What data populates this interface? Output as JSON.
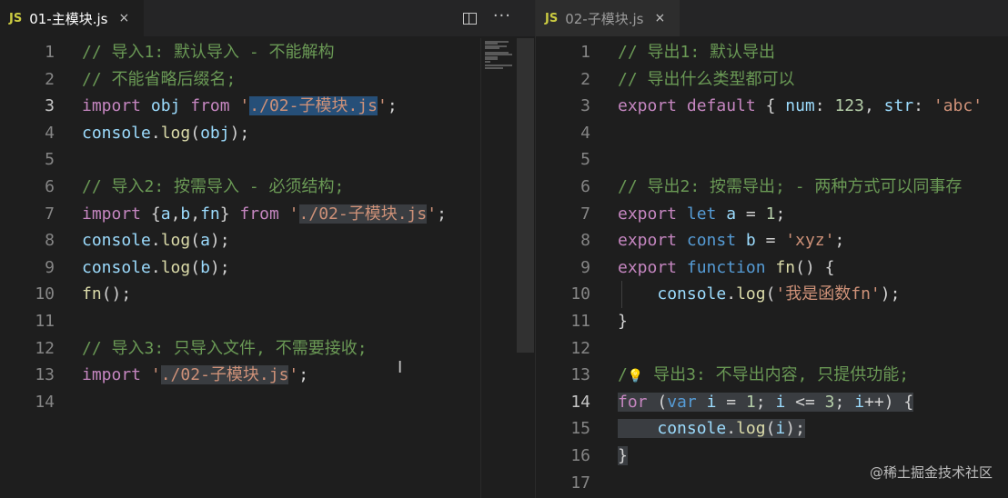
{
  "left": {
    "tab": {
      "badge": "JS",
      "title": "01-主模块.js",
      "close": "×"
    },
    "actions": {
      "more": "···"
    },
    "lines": [
      {
        "num": "1",
        "tokens": [
          {
            "t": "// 导入1: 默认导入 - 不能解构",
            "c": "c"
          }
        ]
      },
      {
        "num": "2",
        "tokens": [
          {
            "t": "// 不能省略后缀名;",
            "c": "c"
          }
        ]
      },
      {
        "num": "3",
        "tokens": [
          {
            "t": "import",
            "c": "kc"
          },
          {
            "t": " ",
            "c": "p"
          },
          {
            "t": "obj",
            "c": "v"
          },
          {
            "t": " ",
            "c": "p"
          },
          {
            "t": "from",
            "c": "kc"
          },
          {
            "t": " '",
            "c": "s"
          },
          {
            "t": "./02-子模块.js",
            "c": "s hl"
          },
          {
            "t": "'",
            "c": "s"
          },
          {
            "t": ";",
            "c": "p"
          }
        ]
      },
      {
        "num": "4",
        "tokens": [
          {
            "t": "console",
            "c": "v"
          },
          {
            "t": ".",
            "c": "p"
          },
          {
            "t": "log",
            "c": "f"
          },
          {
            "t": "(",
            "c": "p"
          },
          {
            "t": "obj",
            "c": "v"
          },
          {
            "t": ");",
            "c": "p"
          }
        ]
      },
      {
        "num": "5",
        "tokens": []
      },
      {
        "num": "6",
        "tokens": [
          {
            "t": "// 导入2: 按需导入 - 必须结构;",
            "c": "c"
          }
        ]
      },
      {
        "num": "7",
        "tokens": [
          {
            "t": "import",
            "c": "kc"
          },
          {
            "t": " {",
            "c": "p"
          },
          {
            "t": "a",
            "c": "v"
          },
          {
            "t": ",",
            "c": "p"
          },
          {
            "t": "b",
            "c": "v"
          },
          {
            "t": ",",
            "c": "p"
          },
          {
            "t": "fn",
            "c": "v"
          },
          {
            "t": "} ",
            "c": "p"
          },
          {
            "t": "from",
            "c": "kc"
          },
          {
            "t": " '",
            "c": "s"
          },
          {
            "t": "./02-子模块.js",
            "c": "s hl2"
          },
          {
            "t": "'",
            "c": "s"
          },
          {
            "t": ";",
            "c": "p"
          }
        ]
      },
      {
        "num": "8",
        "tokens": [
          {
            "t": "console",
            "c": "v"
          },
          {
            "t": ".",
            "c": "p"
          },
          {
            "t": "log",
            "c": "f"
          },
          {
            "t": "(",
            "c": "p"
          },
          {
            "t": "a",
            "c": "v"
          },
          {
            "t": ");",
            "c": "p"
          }
        ]
      },
      {
        "num": "9",
        "tokens": [
          {
            "t": "console",
            "c": "v"
          },
          {
            "t": ".",
            "c": "p"
          },
          {
            "t": "log",
            "c": "f"
          },
          {
            "t": "(",
            "c": "p"
          },
          {
            "t": "b",
            "c": "v"
          },
          {
            "t": ");",
            "c": "p"
          }
        ]
      },
      {
        "num": "10",
        "tokens": [
          {
            "t": "fn",
            "c": "f"
          },
          {
            "t": "();",
            "c": "p"
          }
        ]
      },
      {
        "num": "11",
        "tokens": []
      },
      {
        "num": "12",
        "tokens": [
          {
            "t": "// 导入3: 只导入文件, 不需要接收;",
            "c": "c"
          }
        ]
      },
      {
        "num": "13",
        "tokens": [
          {
            "t": "import",
            "c": "kc"
          },
          {
            "t": " '",
            "c": "s"
          },
          {
            "t": "./02-子模块.js",
            "c": "s hl2"
          },
          {
            "t": "'",
            "c": "s"
          },
          {
            "t": ";",
            "c": "p"
          }
        ]
      },
      {
        "num": "14",
        "tokens": []
      }
    ],
    "current_line": "3"
  },
  "right": {
    "tab": {
      "badge": "JS",
      "title": "02-子模块.js",
      "close": "×"
    },
    "lines": [
      {
        "num": "1",
        "tokens": [
          {
            "t": "// 导出1: 默认导出",
            "c": "c"
          }
        ]
      },
      {
        "num": "2",
        "tokens": [
          {
            "t": "// 导出什么类型都可以",
            "c": "c"
          }
        ]
      },
      {
        "num": "3",
        "tokens": [
          {
            "t": "export",
            "c": "kc"
          },
          {
            "t": " ",
            "c": "p"
          },
          {
            "t": "default",
            "c": "kc"
          },
          {
            "t": " { ",
            "c": "p"
          },
          {
            "t": "num",
            "c": "v"
          },
          {
            "t": ": ",
            "c": "p"
          },
          {
            "t": "123",
            "c": "n"
          },
          {
            "t": ", ",
            "c": "p"
          },
          {
            "t": "str",
            "c": "v"
          },
          {
            "t": ": ",
            "c": "p"
          },
          {
            "t": "'abc'",
            "c": "s"
          }
        ]
      },
      {
        "num": "4",
        "tokens": []
      },
      {
        "num": "5",
        "tokens": []
      },
      {
        "num": "6",
        "tokens": [
          {
            "t": "// 导出2: 按需导出; - 两种方式可以同事存",
            "c": "c"
          }
        ]
      },
      {
        "num": "7",
        "tokens": [
          {
            "t": "export",
            "c": "kc"
          },
          {
            "t": " ",
            "c": "p"
          },
          {
            "t": "let",
            "c": "k"
          },
          {
            "t": " ",
            "c": "p"
          },
          {
            "t": "a",
            "c": "v"
          },
          {
            "t": " = ",
            "c": "p"
          },
          {
            "t": "1",
            "c": "n"
          },
          {
            "t": ";",
            "c": "p"
          }
        ]
      },
      {
        "num": "8",
        "tokens": [
          {
            "t": "export",
            "c": "kc"
          },
          {
            "t": " ",
            "c": "p"
          },
          {
            "t": "const",
            "c": "k"
          },
          {
            "t": " ",
            "c": "p"
          },
          {
            "t": "b",
            "c": "v"
          },
          {
            "t": " = ",
            "c": "p"
          },
          {
            "t": "'xyz'",
            "c": "s"
          },
          {
            "t": ";",
            "c": "p"
          }
        ]
      },
      {
        "num": "9",
        "tokens": [
          {
            "t": "export",
            "c": "kc"
          },
          {
            "t": " ",
            "c": "p"
          },
          {
            "t": "function",
            "c": "k"
          },
          {
            "t": " ",
            "c": "p"
          },
          {
            "t": "fn",
            "c": "f"
          },
          {
            "t": "() {",
            "c": "p"
          }
        ]
      },
      {
        "num": "10",
        "tokens": [
          {
            "t": "    ",
            "c": "p"
          },
          {
            "t": "console",
            "c": "v"
          },
          {
            "t": ".",
            "c": "p"
          },
          {
            "t": "log",
            "c": "f"
          },
          {
            "t": "(",
            "c": "p"
          },
          {
            "t": "'我是函数fn'",
            "c": "s"
          },
          {
            "t": ");",
            "c": "p"
          }
        ]
      },
      {
        "num": "11",
        "tokens": [
          {
            "t": "}",
            "c": "p"
          }
        ]
      },
      {
        "num": "12",
        "tokens": []
      },
      {
        "num": "13",
        "tokens": [
          {
            "t": "/",
            "c": "c"
          },
          {
            "t": "💡",
            "c": "bulb"
          },
          {
            "t": " 导出3: 不导出内容, 只提供功能;",
            "c": "c"
          }
        ]
      },
      {
        "num": "14",
        "tokens": [
          {
            "t": "for",
            "c": "kc sel"
          },
          {
            "t": " (",
            "c": "p sel"
          },
          {
            "t": "var",
            "c": "k sel"
          },
          {
            "t": " ",
            "c": "p sel"
          },
          {
            "t": "i",
            "c": "v sel"
          },
          {
            "t": " = ",
            "c": "p sel"
          },
          {
            "t": "1",
            "c": "n sel"
          },
          {
            "t": "; ",
            "c": "p sel"
          },
          {
            "t": "i",
            "c": "v sel"
          },
          {
            "t": " <= ",
            "c": "p sel"
          },
          {
            "t": "3",
            "c": "n sel"
          },
          {
            "t": "; ",
            "c": "p sel"
          },
          {
            "t": "i",
            "c": "v sel"
          },
          {
            "t": "++) {",
            "c": "p sel"
          }
        ]
      },
      {
        "num": "15",
        "tokens": [
          {
            "t": "    ",
            "c": "p sel"
          },
          {
            "t": "console",
            "c": "v sel"
          },
          {
            "t": ".",
            "c": "p sel"
          },
          {
            "t": "log",
            "c": "f sel"
          },
          {
            "t": "(",
            "c": "p sel"
          },
          {
            "t": "i",
            "c": "v sel"
          },
          {
            "t": ");",
            "c": "p sel"
          }
        ]
      },
      {
        "num": "16",
        "tokens": [
          {
            "t": "}",
            "c": "p sel"
          }
        ]
      },
      {
        "num": "17",
        "tokens": []
      }
    ],
    "current_line": "14"
  },
  "watermark": "@稀土掘金技术社区"
}
